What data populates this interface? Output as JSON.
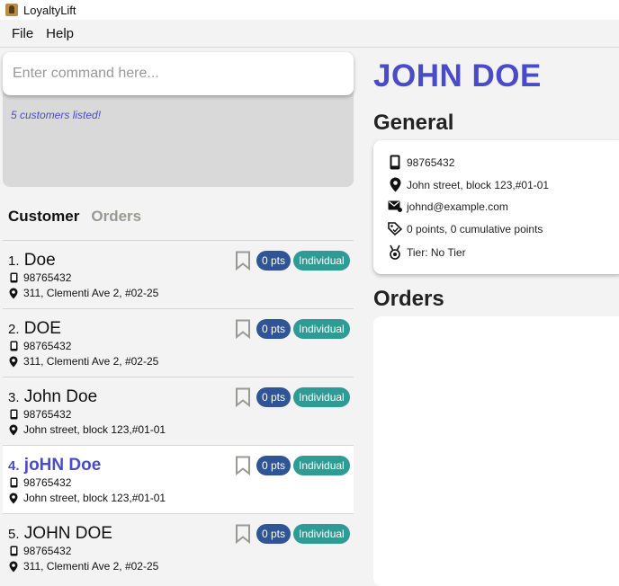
{
  "window": {
    "title": "LoyaltyLift"
  },
  "menu": {
    "file": "File",
    "help": "Help"
  },
  "command": {
    "placeholder": "Enter command here...",
    "result": "5 customers listed!"
  },
  "tabs": {
    "customer": "Customer",
    "orders": "Orders"
  },
  "customers": [
    {
      "index": "1.",
      "name": "Doe",
      "phone": "98765432",
      "address": "311, Clementi Ave 2, #02-25",
      "points": "0 pts",
      "tier": "Individual",
      "selected": false
    },
    {
      "index": "2.",
      "name": "DOE",
      "phone": "98765432",
      "address": "311, Clementi Ave 2, #02-25",
      "points": "0 pts",
      "tier": "Individual",
      "selected": false
    },
    {
      "index": "3.",
      "name": "John Doe",
      "phone": "98765432",
      "address": "John street, block 123,#01-01",
      "points": "0 pts",
      "tier": "Individual",
      "selected": false
    },
    {
      "index": "4.",
      "name": "joHN Doe",
      "phone": "98765432",
      "address": "John street, block 123,#01-01",
      "points": "0 pts",
      "tier": "Individual",
      "selected": true
    },
    {
      "index": "5.",
      "name": "JOHN DOE",
      "phone": "98765432",
      "address": "311, Clementi Ave 2, #02-25",
      "points": "0 pts",
      "tier": "Individual",
      "selected": false
    }
  ],
  "detail": {
    "name": "JOHN DOE",
    "general_title": "General",
    "phone": "98765432",
    "address": "John street, block 123,#01-01",
    "email": "johnd@example.com",
    "points": "0 points, 0 cumulative points",
    "tier": "Tier: No Tier",
    "orders_title": "Orders"
  },
  "colors": {
    "accent": "#4a4bc8",
    "points_badge": "#2f5597",
    "tier_badge": "#2e9c94"
  },
  "icons": [
    "app-icon",
    "phone-icon",
    "location-pin-icon",
    "bookmark-icon",
    "email-icon",
    "points-tag-icon",
    "medal-icon"
  ]
}
